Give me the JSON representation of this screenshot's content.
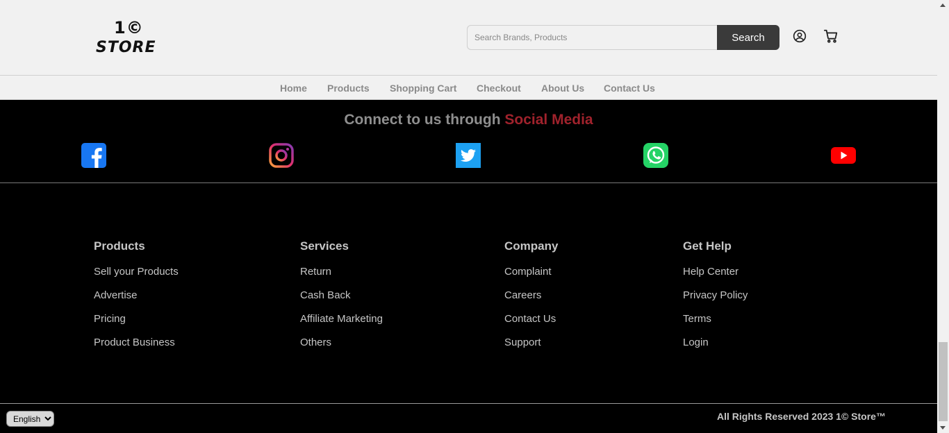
{
  "header": {
    "logo_line1": "1©",
    "logo_line2": "STORE",
    "search_placeholder": "Search Brands, Products",
    "search_button": "Search",
    "user_icon": "user-circle-icon",
    "cart_icon": "shopping-cart-icon"
  },
  "nav": {
    "items": [
      "Home",
      "Products",
      "Shopping Cart",
      "Checkout",
      "About Us",
      "Contact Us"
    ]
  },
  "social": {
    "title_prefix": "Connect to us through ",
    "title_accent": "Social Media",
    "icons": [
      "facebook-icon",
      "instagram-icon",
      "twitter-icon",
      "whatsapp-icon",
      "youtube-icon"
    ]
  },
  "footer": {
    "columns": [
      {
        "heading": "Products",
        "links": [
          "Sell your Products",
          "Advertise",
          "Pricing",
          "Product Business"
        ]
      },
      {
        "heading": "Services",
        "links": [
          "Return",
          "Cash Back",
          "Affiliate Marketing",
          "Others"
        ]
      },
      {
        "heading": "Company",
        "links": [
          "Complaint",
          "Careers",
          "Contact Us",
          "Support"
        ]
      },
      {
        "heading": "Get Help",
        "links": [
          "Help Center",
          "Privacy Policy",
          "Terms",
          "Login"
        ]
      }
    ],
    "language": "English",
    "rights": "All Rights Reserved 2023 1© Store™"
  },
  "colors": {
    "accent": "#a0222c",
    "background": "#000000",
    "header_bg": "#f1f1f1"
  }
}
